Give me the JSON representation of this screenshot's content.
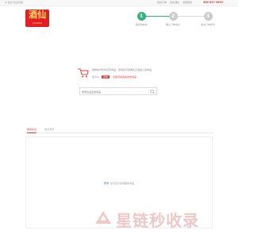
{
  "topbar": {
    "welcome": "Hi 您好 欢迎光临",
    "links": [
      "我的订单",
      "我的酒仙",
      "客服服务"
    ],
    "phone": "400-617-9999"
  },
  "logo": {
    "main": "酒仙",
    "sub": "JIUXIAN"
  },
  "steps": [
    {
      "num": "1",
      "label": "我的购物车"
    },
    {
      "num": "2",
      "label": "确认订单信息"
    },
    {
      "num": "3",
      "label": "提交订单成功"
    }
  ],
  "empty_cart": {
    "line1": "购物车内暂时没有商品，登录后可查看您之前加入的商品",
    "line2_prefix": "您可以",
    "login_label": "登录",
    "link_label": "去首页挑选喜欢的商品"
  },
  "search": {
    "placeholder": "搜索您喜爱的商品"
  },
  "tabs": [
    {
      "label": "我的关注"
    },
    {
      "label": "最近浏览"
    }
  ],
  "panel": {
    "link": "登录",
    "text": "后可显示您收藏的商品"
  },
  "watermark": {
    "text": "星链秒收录"
  },
  "colors": {
    "accent": "#e4393c",
    "step_active": "#2db57a",
    "logo_bg": "#e31e24"
  }
}
